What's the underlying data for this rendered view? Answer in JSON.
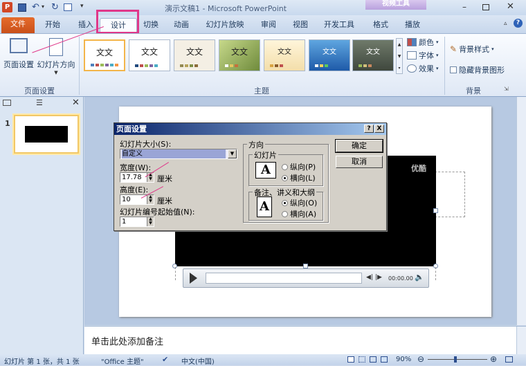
{
  "window": {
    "title": "演示文稿1 - Microsoft PowerPoint",
    "context_tab_group": "视频工具",
    "app_icon_letter": "P"
  },
  "ribbon_tabs": [
    "文件",
    "开始",
    "插入",
    "设计",
    "切换",
    "动画",
    "幻灯片放映",
    "审阅",
    "视图",
    "开发工具",
    "格式",
    "播放"
  ],
  "active_tab": "设计",
  "page_setup_group": {
    "label": "页面设置",
    "page_setup_button": "页面设置",
    "orientation_button": "幻灯片方向"
  },
  "themes_group": {
    "label": "主题",
    "theme_text": "文文",
    "theme_count": 7,
    "side_menu": [
      "颜色",
      "字体",
      "效果"
    ]
  },
  "background_group": {
    "label": "背景",
    "bg_styles": "背景样式",
    "hide_bg": "隐藏背景图形"
  },
  "slide_panel": {
    "slide_number": "1"
  },
  "video": {
    "watermark": "优酷",
    "time": "00:00.00"
  },
  "dialog": {
    "title": "页面设置",
    "size_label": "幻灯片大小(S):",
    "size_value": "自定义",
    "width_label": "宽度(W):",
    "width_value": "17.78",
    "height_label": "高度(E):",
    "height_value": "10",
    "unit": "厘米",
    "start_num_label": "幻灯片编号起始值(N):",
    "start_num_value": "1",
    "orientation_label": "方向",
    "slides_label": "幻灯片",
    "portrait": "纵向(P)",
    "landscape": "横向(L)",
    "notes_label": "备注、讲义和大纲",
    "notes_portrait": "纵向(O)",
    "notes_landscape": "横向(A)",
    "ok": "确定",
    "cancel": "取消",
    "help_btn": "?",
    "close_btn": "X",
    "big_a": "A"
  },
  "notes": {
    "placeholder": "单击此处添加备注"
  },
  "status_bar": {
    "slide_info": "幻灯片 第 1 张，共 1 张",
    "theme": "\"Office 主题\"",
    "language": "中文(中国)",
    "zoom": "90%"
  },
  "colors": {
    "accent_magenta": "#e0388a",
    "file_tab": "#d45b20"
  }
}
